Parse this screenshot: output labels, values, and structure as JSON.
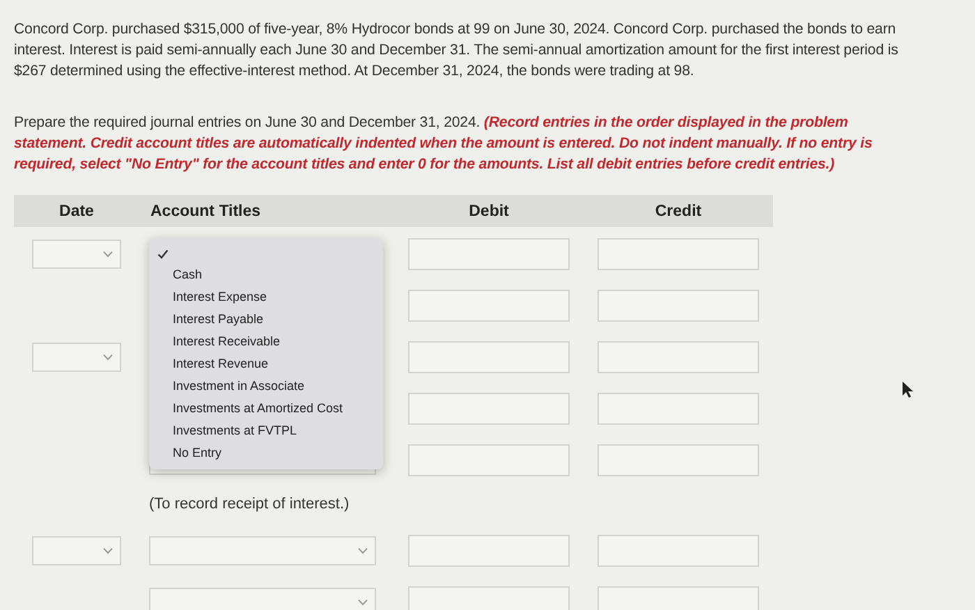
{
  "problem": "Concord Corp. purchased $315,000 of five-year, 8% Hydrocor bonds at 99 on June 30, 2024. Concord Corp. purchased the bonds to earn interest. Interest is paid semi-annually each June 30 and December 31. The semi-annual amortization amount for the first interest period is $267 determined using the effective-interest method. At December 31, 2024, the bonds were trading at 98.",
  "instructions": "Prepare the required journal entries on June 30 and December 31, 2024.",
  "instructions_note": "(Record entries in the order displayed in the problem statement. Credit account titles are automatically indented when the amount is entered. Do not indent manually. If no entry is required, select \"No Entry\" for the account titles and enter 0 for the amounts. List all debit entries before credit entries.)",
  "table": {
    "columns": [
      "Date",
      "Account Titles",
      "Debit",
      "Credit"
    ],
    "rows": [
      {
        "kind": "entry",
        "date_select": true
      },
      {
        "kind": "entry",
        "date_select": false
      },
      {
        "kind": "entry",
        "date_select": true
      },
      {
        "kind": "entry",
        "date_select": false
      },
      {
        "kind": "entry",
        "date_select": false,
        "account_select": true
      },
      {
        "kind": "note",
        "text": "(To record receipt of interest.)"
      },
      {
        "kind": "entry",
        "date_select": true,
        "account_select": true
      },
      {
        "kind": "entry",
        "date_select": false,
        "account_select": true
      }
    ]
  },
  "account_menu": {
    "blank_selected": true,
    "options": [
      {
        "label": "Cash",
        "selected": false
      },
      {
        "label": "Interest Expense",
        "selected": false
      },
      {
        "label": "Interest Payable",
        "selected": false
      },
      {
        "label": "Interest Receivable",
        "selected": false
      },
      {
        "label": "Interest Revenue",
        "selected": false
      },
      {
        "label": "Investment in Associate",
        "selected": false
      },
      {
        "label": "Investments at Amortized Cost",
        "selected": false
      },
      {
        "label": "Investments at FVTPL",
        "selected": false
      },
      {
        "label": "No Entry",
        "selected": false
      }
    ]
  }
}
